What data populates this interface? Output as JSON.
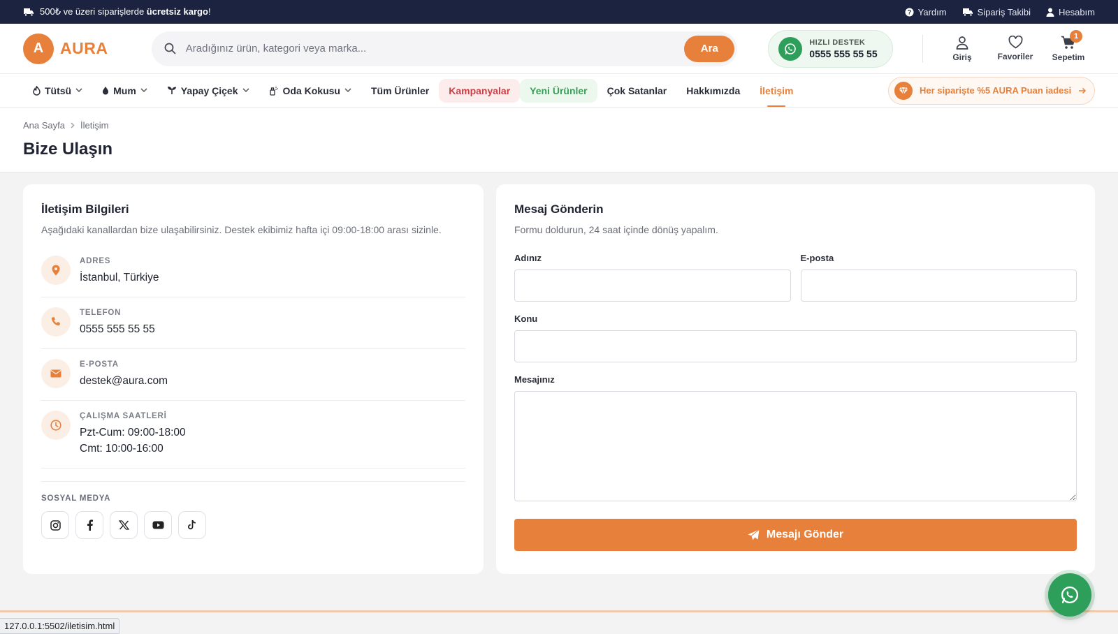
{
  "topbar": {
    "shipping_pre": "500₺ ve üzeri siparişlerde ",
    "shipping_bold": "ücretsiz kargo",
    "shipping_post": "!",
    "links": [
      "Yardım",
      "Sipariş Takibi",
      "Hesabım"
    ]
  },
  "header": {
    "logo_letter": "A",
    "logo_text": "AURA",
    "search_placeholder": "Aradığınız ürün, kategori veya marka...",
    "search_button": "Ara",
    "support_label": "HIZLI DESTEK",
    "support_phone": "0555 555 55 55",
    "icons": {
      "login": "Giriş",
      "favorites": "Favoriler",
      "cart": "Sepetim",
      "cart_count": "1"
    }
  },
  "nav": {
    "items": [
      "Tütsü",
      "Mum",
      "Yapay Çiçek",
      "Oda Kokusu",
      "Tüm Ürünler",
      "Kampanyalar",
      "Yeni Ürünler",
      "Çok Satanlar",
      "Hakkımızda",
      "İletişim"
    ],
    "promo": "Her siparişte %5 AURA Puan iadesi"
  },
  "breadcrumb": [
    "Ana Sayfa",
    "İletişim"
  ],
  "page_title": "Bize Ulaşın",
  "info": {
    "title": "İletişim Bilgileri",
    "desc": "Aşağıdaki kanallardan bize ulaşabilirsiniz. Destek ekibimiz hafta içi 09:00-18:00 arası sizinle.",
    "address_label": "ADRES",
    "address_value": "İstanbul, Türkiye",
    "phone_label": "TELEFON",
    "phone_value": "0555 555 55 55",
    "email_label": "E-POSTA",
    "email_value": "destek@aura.com",
    "hours_label": "ÇALIŞMA SAATLERİ",
    "hours_line1": "Pzt-Cum: 09:00-18:00",
    "hours_line2": "Cmt: 10:00-16:00",
    "social_label": "SOSYAL MEDYA"
  },
  "form": {
    "title": "Mesaj Gönderin",
    "desc": "Formu doldurun, 24 saat içinde dönüş yapalım.",
    "name_label": "Adınız",
    "email_label": "E-posta",
    "subject_label": "Konu",
    "message_label": "Mesajınız",
    "submit": "Mesajı Gönder"
  },
  "status_url": "127.0.0.1:5502/iletisim.html",
  "colors": {
    "accent": "#e7803a",
    "dark": "#1b2340",
    "whatsapp": "#2e9e5b"
  }
}
